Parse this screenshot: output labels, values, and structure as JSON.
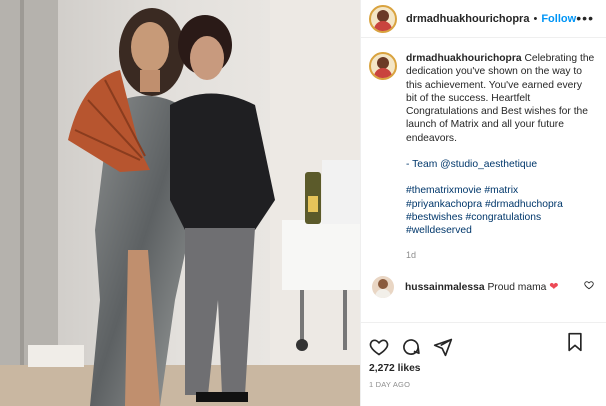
{
  "post": {
    "username": "drmadhuakhourichopra",
    "follow_label": "Follow",
    "caption": {
      "username": "drmadhuakhourichopra",
      "lines": [
        "Celebrating the",
        "dedication you've shown on the way to",
        "this achievement. You've earned every",
        "bit of the success. Heartfelt",
        "Congratulations and Best wishes for the",
        "launch of Matrix and all your future",
        "endeavors."
      ],
      "team_line": "- Team @studio_aesthetique",
      "hashtag_lines": [
        "#thematrixmovie #matrix",
        "#priyankachopra #drmadhuchopra",
        "#bestwishes #congratulations",
        "#welldeserved"
      ],
      "time": "1d"
    },
    "comment": {
      "username": "hussainmalessa",
      "text": "Proud mama"
    },
    "likes": "2,272 likes",
    "posted": "1 DAY AGO"
  },
  "icons": [
    "more-options-icon",
    "heart-icon",
    "comment-icon",
    "share-icon",
    "save-icon"
  ],
  "colors": {
    "accent": "#0095f6",
    "hashtag": "#00376b",
    "heart": "#ed4956"
  }
}
